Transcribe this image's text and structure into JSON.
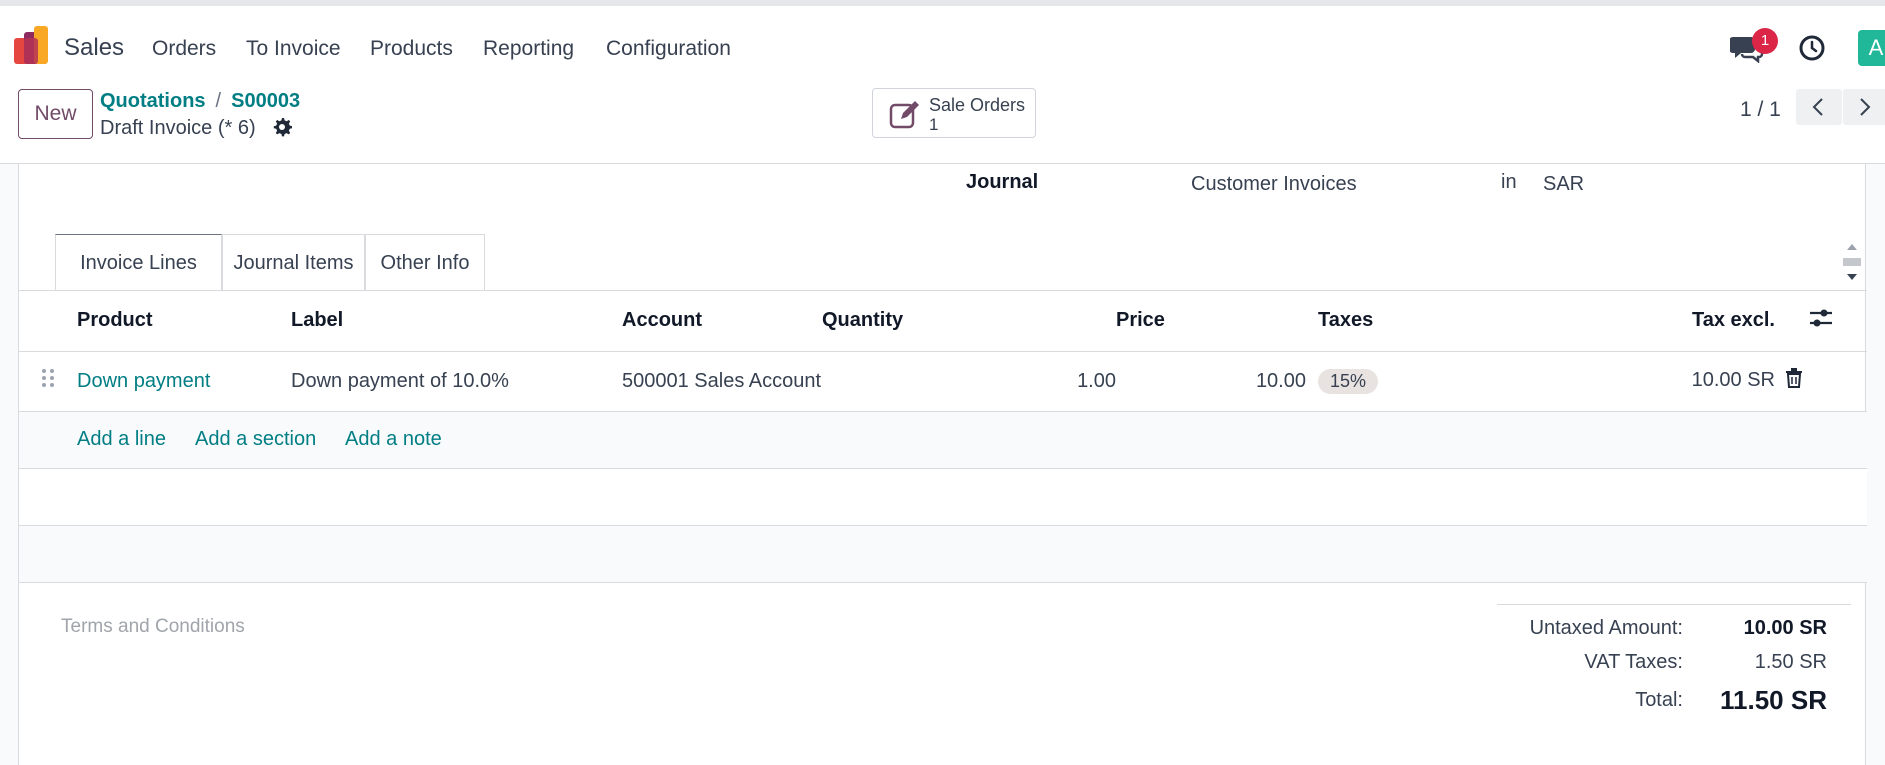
{
  "nav": {
    "app_name": "Sales",
    "items": [
      "Orders",
      "To Invoice",
      "Products",
      "Reporting",
      "Configuration"
    ],
    "chat_badge": "1",
    "avatar_letter": "A"
  },
  "control": {
    "new_label": "New",
    "breadcrumb": [
      "Quotations",
      "S00003"
    ],
    "breadcrumb_sep": "/",
    "record_title": "Draft Invoice (* 6)",
    "smart_button": {
      "label": "Sale Orders",
      "count": "1"
    },
    "pager": "1 / 1"
  },
  "form": {
    "journal_label": "Journal",
    "journal_value": "Customer Invoices",
    "journal_in": "in",
    "journal_currency": "SAR"
  },
  "tabs": [
    "Invoice Lines",
    "Journal Items",
    "Other Info"
  ],
  "table": {
    "columns": {
      "product": "Product",
      "label": "Label",
      "account": "Account",
      "quantity": "Quantity",
      "price": "Price",
      "taxes": "Taxes",
      "tax_excl": "Tax excl."
    },
    "rows": [
      {
        "product": "Down payment",
        "label": "Down payment of 10.0%",
        "account": "500001 Sales Account",
        "quantity": "1.00",
        "price": "10.00",
        "taxes": "15%",
        "tax_excl": "10.00 SR"
      }
    ],
    "add_line": "Add a line",
    "add_section": "Add a section",
    "add_note": "Add a note"
  },
  "footer": {
    "terms_placeholder": "Terms and Conditions",
    "untaxed_label": "Untaxed Amount:",
    "untaxed_value": "10.00 SR",
    "vat_label": "VAT Taxes:",
    "vat_value": "1.50 SR",
    "total_label": "Total:",
    "total_value": "11.50 SR"
  },
  "colors": {
    "brand": "#714b67",
    "link": "#017e84",
    "badge": "#dc2647",
    "avatar": "#21b799"
  }
}
